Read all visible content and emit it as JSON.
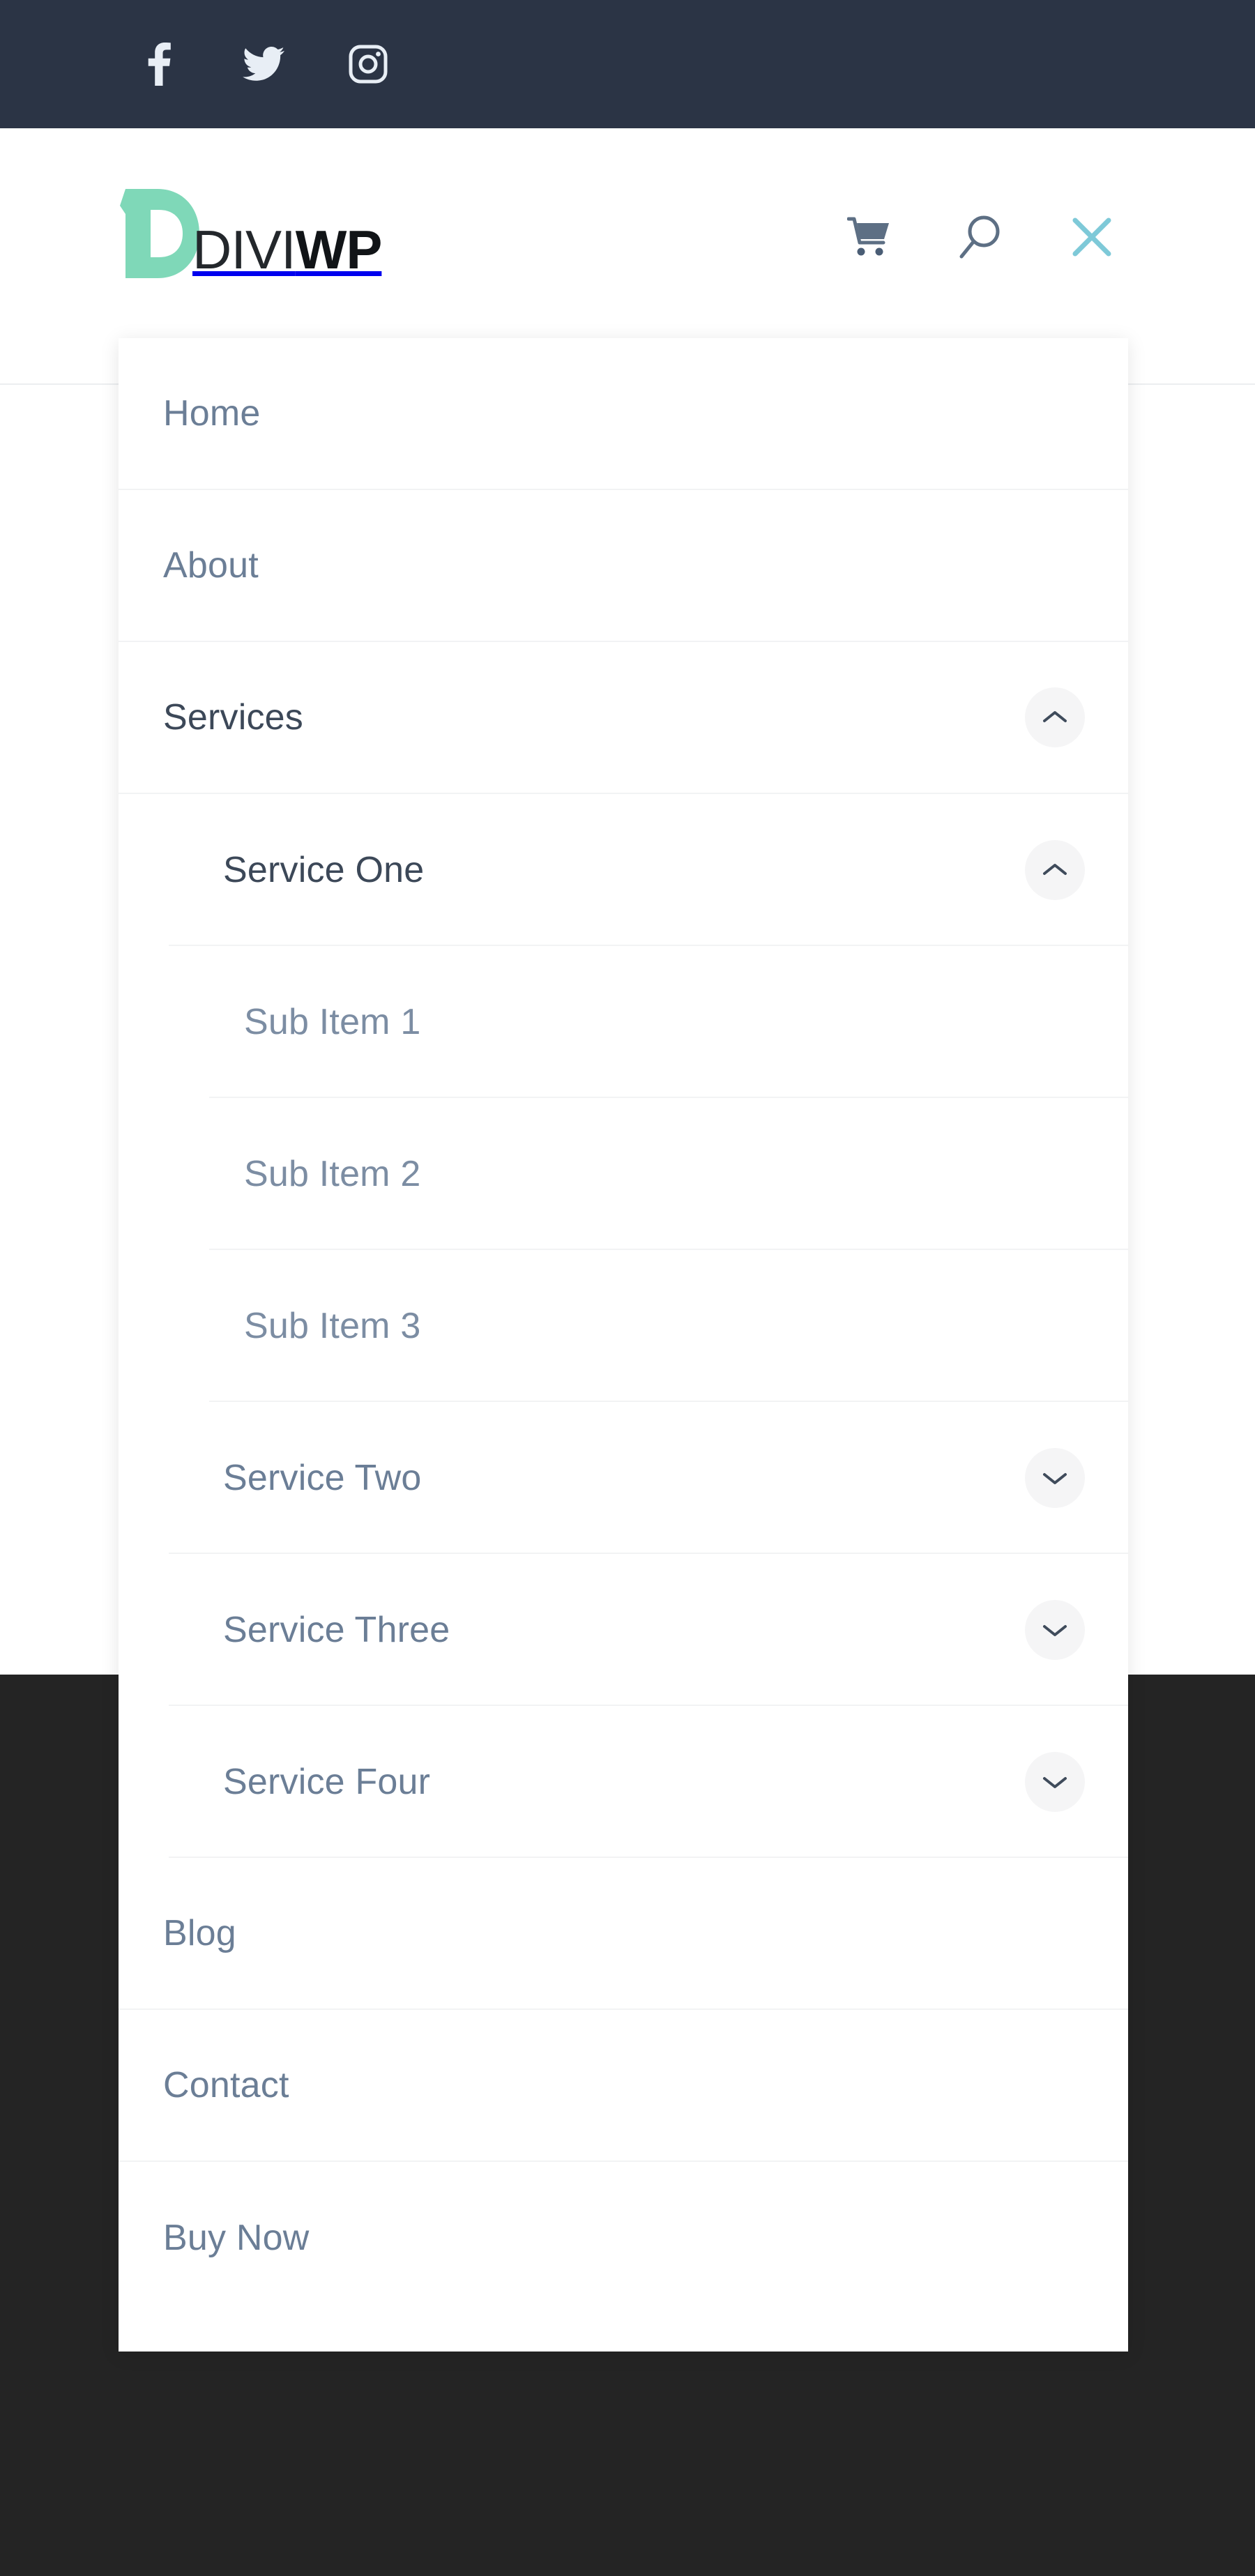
{
  "colors": {
    "social_bar_bg": "#2b3445",
    "logo_mark": "#7fd8b8",
    "dark_section_bg": "#242424",
    "menu_link": "#6b7e96",
    "menu_link_active": "#3c4858",
    "close_icon": "#7ec9d8",
    "header_icon": "#5d6f84",
    "toggle_bg": "#f5f5f6",
    "divider": "#f2f3f4"
  },
  "social_bar": {
    "items": [
      {
        "icon": "facebook-icon",
        "label": "Facebook"
      },
      {
        "icon": "twitter-icon",
        "label": "Twitter"
      },
      {
        "icon": "instagram-icon",
        "label": "Instagram"
      }
    ]
  },
  "header": {
    "logo": {
      "mark_icon": "diviwp-d-mark-icon",
      "text_thin": "DIVI",
      "text_bold": "WP"
    },
    "icons": [
      {
        "icon": "cart-icon",
        "label": "Cart"
      },
      {
        "icon": "search-icon",
        "label": "Search"
      },
      {
        "icon": "close-icon",
        "label": "Close Menu"
      }
    ]
  },
  "menu": {
    "items": [
      {
        "label": "Home",
        "depth": 0,
        "toggle": null
      },
      {
        "label": "About",
        "depth": 0,
        "toggle": null
      },
      {
        "label": "Services",
        "depth": 0,
        "toggle": "expanded",
        "active": true
      },
      {
        "label": "Service One",
        "depth": 1,
        "toggle": "expanded",
        "active": true
      },
      {
        "label": "Sub Item 1",
        "depth": 2,
        "toggle": null
      },
      {
        "label": "Sub Item 2",
        "depth": 2,
        "toggle": null
      },
      {
        "label": "Sub Item 3",
        "depth": 2,
        "toggle": null
      },
      {
        "label": "Service Two",
        "depth": 1,
        "toggle": "collapsed"
      },
      {
        "label": "Service Three",
        "depth": 1,
        "toggle": "collapsed"
      },
      {
        "label": "Service Four",
        "depth": 1,
        "toggle": "collapsed"
      },
      {
        "label": "Blog",
        "depth": 0,
        "toggle": null
      },
      {
        "label": "Contact",
        "depth": 0,
        "toggle": null
      },
      {
        "label": "Buy Now",
        "depth": 0,
        "toggle": null
      }
    ]
  }
}
